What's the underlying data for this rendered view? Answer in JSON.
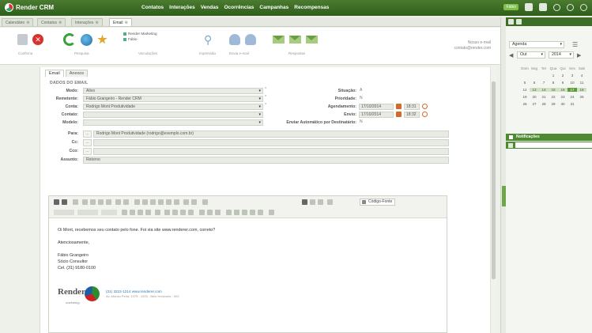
{
  "app": {
    "title": "Render CRM"
  },
  "nav": [
    "Contatos",
    "Interações",
    "Vendas",
    "Ocorrências",
    "Campanhas",
    "Recompensas"
  ],
  "top_right": {
    "user_label": "Fábio"
  },
  "doc_tabs": [
    {
      "label": "Calendário"
    },
    {
      "label": "Contatos"
    },
    {
      "label": "Interações"
    },
    {
      "label": "Email"
    }
  ],
  "toolbar": {
    "groups": [
      "Confirma",
      "Pesquisa",
      "Vinculações",
      "Impressão",
      "Envia e-mail",
      "Respostas"
    ],
    "linked": [
      "Render Marketing",
      "Fábio"
    ],
    "right_label": "Nosso e-mail",
    "right_value": "contato@render.com"
  },
  "form": {
    "tabs": [
      "Email",
      "Anexos"
    ],
    "section_title": "DADOS DO EMAIL",
    "labels": {
      "modo": "Modo:",
      "remetente": "Remetente:",
      "conta": "Conta:",
      "contato": "Contato:",
      "modelo": "Modelo:",
      "situacao": "Situação:",
      "prioridade": "Prioridade:",
      "agendamento": "Agendamento:",
      "envio": "Envio:",
      "envio_auto": "Enviar Automático por Destinatário:",
      "para": "Para:",
      "cc": "Cc:",
      "cco": "Cco:",
      "assunto": "Assunto:"
    },
    "values": {
      "modo": "Ativo",
      "remetente": "Fábio Grangeiro - Render CRM",
      "conta": "Rodrigo Mont Produtividade",
      "contato": "",
      "modelo": "",
      "situacao": "A",
      "prioridade": "N",
      "agendamento_date": "17/10/2014",
      "agendamento_time": "18:31",
      "envio_date": "17/10/2014",
      "envio_time": "18:32",
      "envio_auto": "N",
      "para": "Rodrigo Mont Produtividade (rodrigo@exemplo.com.br)",
      "cc": "",
      "cco": "",
      "assunto": "Retorno"
    },
    "addr_button": "..."
  },
  "editor": {
    "codigo_fonte": "Código-Fonte",
    "font_select": "Fonte",
    "size_select": "Tam.",
    "style_select": "Estilo",
    "body_lines": [
      "Oi Mont, recebemos seu contato pelo fone. Foi via site www.renderer.com, correto?",
      "Atenciosamente,",
      "Fábio Grangeiro",
      "Sócio Consultor",
      "Cel. (31) 9180-0100"
    ],
    "signature": {
      "logo_text": "Render",
      "logo_sub": "marketing",
      "phone_site": "(31) 3222-1214  www.renderer.com",
      "address": "Av. Afonso Pena, 1075 - 1003 - Belo Horizonte - MG"
    }
  },
  "right_panel": {
    "view_select": "Agenda",
    "month_select": "Out",
    "year_select": "2014",
    "cal_headers": [
      "Dom",
      "Seg",
      "Ter",
      "Qua",
      "Qui",
      "Sex",
      "Sab"
    ],
    "cal_rows": [
      [
        "",
        "",
        "",
        "1",
        "2",
        "3",
        "4"
      ],
      [
        "5",
        "6",
        "7",
        "8",
        "9",
        "10",
        "11"
      ],
      [
        "12",
        "13",
        "14",
        "15",
        "16",
        "17",
        "18"
      ],
      [
        "19",
        "20",
        "21",
        "22",
        "23",
        "24",
        "25"
      ],
      [
        "26",
        "27",
        "28",
        "29",
        "30",
        "31",
        ""
      ]
    ],
    "notifications_title": "Notificações"
  }
}
